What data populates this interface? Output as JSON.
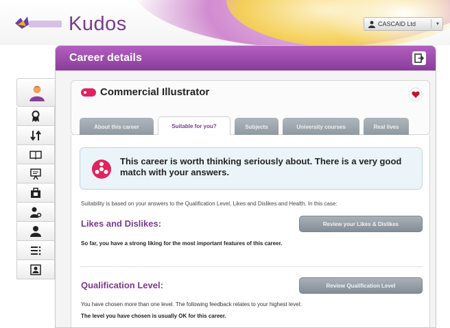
{
  "app": {
    "title": "Kudos",
    "logo_text": "CASCAID"
  },
  "user_menu": {
    "label": "CASCAID Ltd",
    "icon": "user-icon"
  },
  "sidebar": {
    "items": [
      {
        "name": "profile",
        "icon": "person-avatar-icon",
        "active": true
      },
      {
        "name": "awards",
        "icon": "ribbon-award-icon"
      },
      {
        "name": "sort",
        "icon": "sort-arrows-icon"
      },
      {
        "name": "book",
        "icon": "open-book-icon"
      },
      {
        "name": "presentation",
        "icon": "presentation-board-icon"
      },
      {
        "name": "work",
        "icon": "briefcase-icon"
      },
      {
        "name": "user-settings",
        "icon": "person-gear-icon"
      },
      {
        "name": "people",
        "icon": "person-icon"
      },
      {
        "name": "checklist",
        "icon": "checklist-icon"
      },
      {
        "name": "contact",
        "icon": "contact-card-icon"
      }
    ]
  },
  "panel": {
    "title": "Career details",
    "export_icon": "export-icon"
  },
  "career": {
    "name": "Commercial Illustrator",
    "tag_color": "#e0245e",
    "heart_color": "#c4122f"
  },
  "tabs": [
    {
      "label": "About this career",
      "active": false
    },
    {
      "label": "Suitable for you?",
      "active": true
    },
    {
      "label": "Subjects",
      "active": false
    },
    {
      "label": "University courses",
      "active": false
    },
    {
      "label": "Real lives",
      "active": false
    }
  ],
  "match": {
    "message": "This career is worth thinking seriously about. There is a very good match with your answers.",
    "icon_color": "#e0245e"
  },
  "suitability_note": "Suitability is based on your answers to the Qualification Level, Likes and Dislikes and Health. In this case:",
  "likes": {
    "title": "Likes and Dislikes:",
    "button": "Review your Likes & Dislikes",
    "text": "So far, you have a strong liking for the most important features of this career."
  },
  "qualification": {
    "title": "Qualification Level:",
    "button": "Review Qualification Level",
    "text1": "You have chosen more than one level. The following feedback relates to your highest level:",
    "text2": "The level you have chosen is usually OK for this career."
  },
  "colors": {
    "brand_purple": "#8a3d9c",
    "accent_pink": "#e0245e",
    "tab_grey": "#8f98a1"
  }
}
